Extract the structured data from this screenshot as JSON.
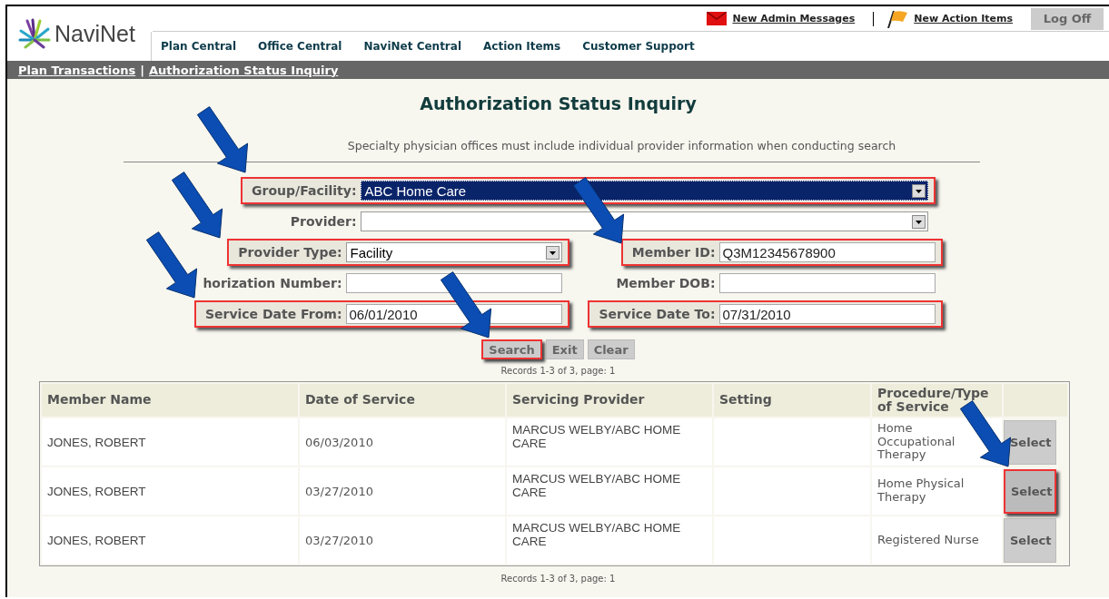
{
  "logo": {
    "text": "NaviNet"
  },
  "header_links": [
    {
      "label": "New Admin Messages",
      "kind": "mail"
    },
    {
      "label": "New Action Items",
      "kind": "flag"
    }
  ],
  "logoff_button": "Log Off",
  "nav_tabs": [
    "Plan Central",
    "Office Central",
    "NaviNet Central",
    "Action Items",
    "Customer Support"
  ],
  "breadcrumb": {
    "separator": "|",
    "items": [
      "Plan Transactions",
      "Authorization Status Inquiry"
    ]
  },
  "title": "Authorization Status Inquiry",
  "note": "Specialty physician offices must include individual provider information when conducting search",
  "form": {
    "rows": [
      {
        "fields": [
          {
            "label": "Group/Facility:",
            "value": "ABC Home Care",
            "kind": "select",
            "wide": true,
            "focused": true,
            "highlighted": true
          }
        ]
      },
      {
        "fields": [
          {
            "label": "Provider:",
            "kind": "select",
            "wide": true,
            "focused": false,
            "highlighted": false
          }
        ]
      },
      {
        "fields": [
          {
            "label": "Provider Type:",
            "value": "Facility",
            "kind": "select",
            "wide": false,
            "focused": false,
            "highlighted": true
          },
          {
            "label": "Member ID:",
            "value": "Q3M12345678900",
            "kind": "text",
            "wide": false,
            "focused": false,
            "highlighted": true
          }
        ]
      },
      {
        "fields": [
          {
            "label": "horization Number:",
            "kind": "text",
            "wide": false,
            "focused": false,
            "highlighted": false
          },
          {
            "label": "Member DOB:",
            "kind": "text",
            "wide": false,
            "focused": false,
            "highlighted": false
          }
        ]
      },
      {
        "fields": [
          {
            "label": "Service Date From:",
            "value": "06/01/2010",
            "kind": "text",
            "wide": false,
            "focused": false,
            "highlighted": true
          },
          {
            "label": "Service Date To:",
            "value": "07/31/2010",
            "kind": "text",
            "wide": false,
            "focused": false,
            "highlighted": true
          }
        ]
      }
    ]
  },
  "buttons": [
    {
      "label": "Search",
      "highlighted": true
    },
    {
      "label": "Exit",
      "highlighted": false
    },
    {
      "label": "Clear",
      "highlighted": false
    }
  ],
  "records_top": "Records 1-3 of 3, page:  1",
  "table": {
    "columns": [
      "Member Name",
      "Date of Service",
      "Servicing Provider",
      "Setting",
      "Procedure/Type of Service"
    ],
    "rows": [
      {
        "cells": [
          "JONES, ROBERT",
          "06/03/2010",
          "MARCUS WELBY/ABC HOME CARE",
          "",
          "Home Occupational Therapy"
        ],
        "action": "Select",
        "highlighted": false
      },
      {
        "cells": [
          "JONES, ROBERT",
          "03/27/2010",
          "MARCUS WELBY/ABC HOME CARE",
          "",
          "Home Physical Therapy"
        ],
        "action": "Select",
        "highlighted": true
      },
      {
        "cells": [
          "JONES, ROBERT",
          "03/27/2010",
          "MARCUS WELBY/ABC HOME CARE",
          "",
          "Registered Nurse"
        ],
        "action": "Select",
        "highlighted": false
      }
    ]
  },
  "records_bottom": "Records 1-3 of 3, page:  1"
}
